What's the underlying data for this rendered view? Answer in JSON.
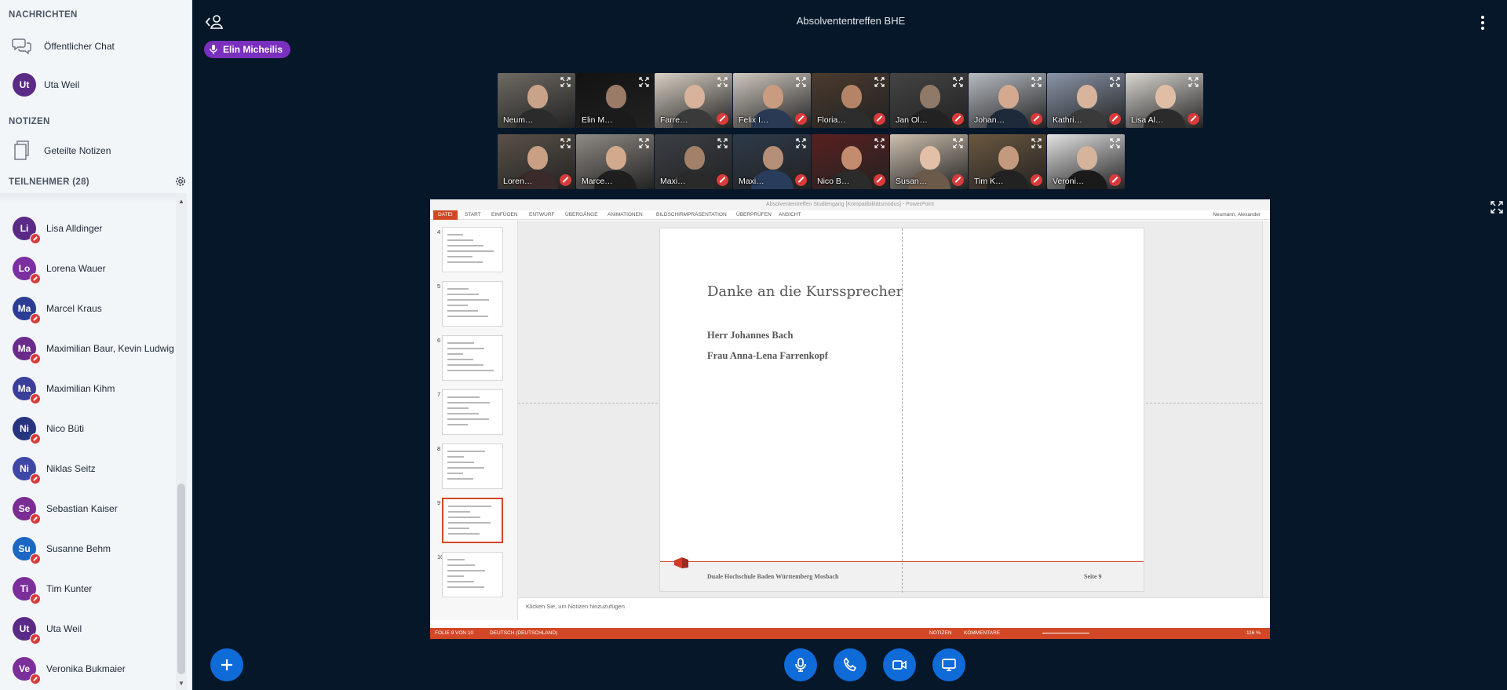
{
  "sidebar": {
    "messages_title": "NACHRICHTEN",
    "public_chat": "Öffentlicher Chat",
    "chat_user": {
      "initials": "Ut",
      "name": "Uta Weil",
      "color": "#5b2a86"
    },
    "notes_title": "NOTIZEN",
    "shared_notes": "Geteilte Notizen",
    "participants_title": "TEILNEHMER (28)",
    "participants": [
      {
        "initials": "Li",
        "name": "Lisa Alldinger",
        "color": "#5b2a86"
      },
      {
        "initials": "Lo",
        "name": "Lorena Wauer",
        "color": "#7b2fa0"
      },
      {
        "initials": "Ma",
        "name": "Marcel Kraus",
        "color": "#2d3d94"
      },
      {
        "initials": "Ma",
        "name": "Maximilian Baur, Kevin Ludwig",
        "color": "#6a2b8a"
      },
      {
        "initials": "Ma",
        "name": "Maximilian Kihm",
        "color": "#3b3f9a"
      },
      {
        "initials": "Ni",
        "name": "Nico Büti",
        "color": "#27357f"
      },
      {
        "initials": "Ni",
        "name": "Niklas Seitz",
        "color": "#3f47a6"
      },
      {
        "initials": "Se",
        "name": "Sebastian Kaiser",
        "color": "#7a2d93"
      },
      {
        "initials": "Su",
        "name": "Susanne Behm",
        "color": "#1d67c4"
      },
      {
        "initials": "Ti",
        "name": "Tim Kunter",
        "color": "#7b2f9b"
      },
      {
        "initials": "Ut",
        "name": "Uta Weil",
        "color": "#5b2a86"
      },
      {
        "initials": "Ve",
        "name": "Veronika Bukmaier",
        "color": "#7b2f9b"
      }
    ]
  },
  "header": {
    "title": "Absolvententreffen BHE",
    "current_speaker": "Elin Micheilis"
  },
  "videos": [
    {
      "label": "Neum…",
      "bg": "#6e6a63",
      "skin": "#c9a28a",
      "shirt": "#2b2b2b",
      "muted": false
    },
    {
      "label": "Elin M…",
      "bg": "#121212",
      "skin": "#9a7b68",
      "shirt": "#1b1b1b",
      "muted": false,
      "active": true
    },
    {
      "label": "Farre…",
      "bg": "#d8d0c4",
      "skin": "#d8b29a",
      "shirt": "#3a3a3a",
      "muted": true
    },
    {
      "label": "Felix I…",
      "bg": "#cfc8bf",
      "skin": "#c99b80",
      "shirt": "#2a3a55",
      "muted": true
    },
    {
      "label": "Floria…",
      "bg": "#4b3a2e",
      "skin": "#b58467",
      "shirt": "#2d2d2d",
      "muted": true
    },
    {
      "label": "Jan Ol…",
      "bg": "#444444",
      "skin": "#8f7a6a",
      "shirt": "#222222",
      "muted": true
    },
    {
      "label": "Johan…",
      "bg": "#b7bcc2",
      "skin": "#d3a98f",
      "shirt": "#1e2a3a",
      "muted": true
    },
    {
      "label": "Kathri…",
      "bg": "#8a95a8",
      "skin": "#d8b49c",
      "shirt": "#3a3a3a",
      "muted": true
    },
    {
      "label": "Lisa Al…",
      "bg": "#d9d6d0",
      "skin": "#e0bea6",
      "shirt": "#2b2b2b",
      "muted": true
    },
    {
      "label": "Loren…",
      "bg": "#5a5148",
      "skin": "#c9a083",
      "shirt": "#3a2a2a",
      "muted": true
    },
    {
      "label": "Marce…",
      "bg": "#8f8a84",
      "skin": "#d1a98c",
      "shirt": "#1e1e1e",
      "muted": false
    },
    {
      "label": "Maxi…",
      "bg": "#3b3f45",
      "skin": "#a38068",
      "shirt": "#2a2a2a",
      "muted": true
    },
    {
      "label": "Maxi…",
      "bg": "#2e3a4a",
      "skin": "#b58f78",
      "shirt": "#2a3c5c",
      "muted": true
    },
    {
      "label": "Nico B…",
      "bg": "#5a2020",
      "skin": "#c48c6e",
      "shirt": "#2b2b2b",
      "muted": true
    },
    {
      "label": "Susan…",
      "bg": "#cdbfae",
      "skin": "#e2c0a8",
      "shirt": "#6b5a4a",
      "muted": true
    },
    {
      "label": "Tim K…",
      "bg": "#6b5840",
      "skin": "#c39a7d",
      "shirt": "#222222",
      "muted": true
    },
    {
      "label": "Veroni…",
      "bg": "#e2e2e2",
      "skin": "#d6b39b",
      "shirt": "#1a1a1a",
      "muted": true
    }
  ],
  "presentation": {
    "window_title": "Absolvententreffen Studiengang [Kompatibilitätsmodus] - PowerPoint",
    "tabs": [
      "DATEI",
      "START",
      "EINFÜGEN",
      "ENTWURF",
      "ÜBERGÄNGE",
      "ANIMATIONEN",
      "BILDSCHIRMPRÄSENTATION",
      "ÜBERPRÜFEN",
      "ANSICHT"
    ],
    "user_name": "Neumann, Alexander",
    "slide_numbers": [
      "4",
      "5",
      "6",
      "7",
      "8",
      "9",
      "10"
    ],
    "slide_title": "Danke an die Kurssprecher",
    "line1": "Herr Johannes Bach",
    "line2": "Frau Anna-Lena Farrenkopf",
    "footer_text": "Duale Hochschule Baden Württemberg Mosbach",
    "page_label": "Seite 9",
    "notes_placeholder": "Klicken Sie, um Notizen hinzuzufügen",
    "status_slide": "FOLIE 9 VON 10",
    "status_language": "DEUTSCH (DEUTSCHLAND)",
    "status_notes": "NOTIZEN",
    "status_comments": "KOMMENTARE",
    "zoom": "116 %"
  },
  "controls": {
    "plus": "plus-icon",
    "mic": "microphone-icon",
    "phone": "phone-icon",
    "camera": "camera-icon",
    "screen": "screen-share-icon"
  }
}
